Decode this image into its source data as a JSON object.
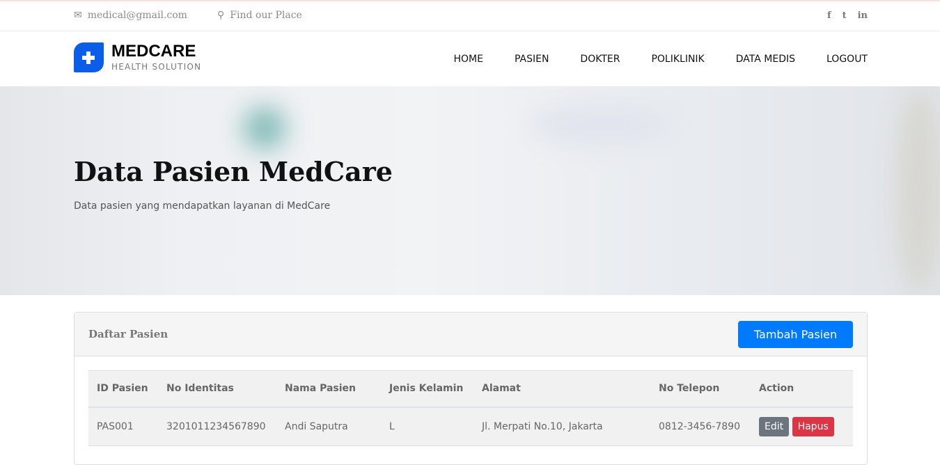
{
  "topbar": {
    "email": "medical@gmail.com",
    "location": "Find our Place",
    "social": [
      "f",
      "t",
      "in"
    ]
  },
  "brand": {
    "name": "MEDCARE",
    "tagline": "HEALTH SOLUTION"
  },
  "nav": [
    "HOME",
    "PASIEN",
    "DOKTER",
    "POLIKLINIK",
    "DATA MEDIS",
    "LOGOUT"
  ],
  "hero": {
    "title": "Data Pasien MedCare",
    "subtitle": "Data pasien yang mendapatkan layanan di MedCare"
  },
  "card": {
    "title": "Daftar Pasien",
    "add_label": "Tambah Pasien"
  },
  "table": {
    "headers": [
      "ID Pasien",
      "No Identitas",
      "Nama Pasien",
      "Jenis Kelamin",
      "Alamat",
      "No Telepon",
      "Action"
    ],
    "rows": [
      [
        "PAS001",
        "3201011234567890",
        "Andi Saputra",
        "L",
        "Jl. Merpati No.10, Jakarta",
        "0812-3456-7890"
      ]
    ],
    "edit_label": "Edit",
    "delete_label": "Hapus"
  },
  "colors": {
    "primary": "#007bff",
    "danger": "#dc3545",
    "secondary": "#6c757d",
    "brand": "#0b5ee8"
  }
}
